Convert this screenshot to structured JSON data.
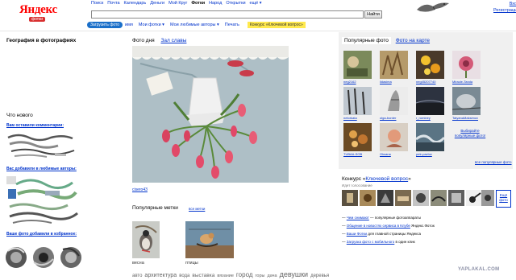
{
  "header": {
    "logo_text": "Яндекс",
    "logo_sub": "фотки",
    "services": [
      "Поиск",
      "Почта",
      "Календарь",
      "Деньги",
      "Мой Круг",
      "Фотки",
      "Народ",
      "Открытки",
      "ещё ▾"
    ],
    "current_service_index": 5,
    "search_button": "Найти",
    "login": "Вход",
    "register": "Регистрация"
  },
  "subnav": {
    "upload": "Загрузить фото",
    "user": "имя",
    "items": [
      "Мои фотки ▾",
      "Мои любимые авторы ▾",
      "Печать"
    ],
    "contest": "Конкурс «Ключевой вопрос»"
  },
  "left": {
    "geo_title": "География в фотографиях",
    "whatsnew_title": "Что нового",
    "new_comments": "Вам оставили комментарии:",
    "new_authors": "Вас добавили в любимые авторы:",
    "new_favorites": "Ваше фото добавили в избранное:"
  },
  "middle": {
    "tab_day": "Фото дня",
    "tab_fame": "Зал славы",
    "author": "cisero43",
    "tags_title": "Популярные метки",
    "tags_all": "все метки",
    "tag1": "весна",
    "tag2": "птицы",
    "tag_cloud": [
      {
        "t": "авто",
        "s": 6
      },
      {
        "t": "архитектура",
        "s": 7
      },
      {
        "t": "вода",
        "s": 6
      },
      {
        "t": "выставка",
        "s": 6.5
      },
      {
        "t": "вязание",
        "s": 5.5
      },
      {
        "t": "город",
        "s": 8
      },
      {
        "t": "горы",
        "s": 5.5
      },
      {
        "t": "дача",
        "s": 5.5
      },
      {
        "t": "девушки",
        "s": 9
      },
      {
        "t": "деревья",
        "s": 6
      }
    ]
  },
  "right": {
    "tab_popular": "Популярные фото",
    "tab_map": "Фото на карте",
    "captions": [
      "neg2162",
      "ildasima",
      "neg45207740",
      "Miracle-Tanda",
      "netorkata",
      "olga-border",
      "r_rominey",
      "TatyanaMaksimov",
      "TUBAA-SOB",
      "Oksana",
      "petr-pavlov"
    ],
    "choose_popular": "Выбирайте популярные фото!",
    "all_popular": "все популярные фото",
    "contest_title_prefix": "Конкурс «",
    "contest_title_link": "Ключевой вопрос",
    "contest_title_suffix": "»",
    "contest_sub": "Идет голосование",
    "vote": "Ещё фото",
    "features": [
      {
        "link": "Чем снимают",
        "rest": " — популярные фотоаппараты"
      },
      {
        "link": "Общение в новостях сервиса в Клубе",
        "rest": " Яндекс.Фоток"
      },
      {
        "link": "Ваши Фотки",
        "rest": " для главной страницы Яндекса"
      },
      {
        "link": "Загрузка фото с мобильного",
        "rest": " в один клик"
      }
    ]
  },
  "watermark": "YAPLAKAL.COM",
  "colors": {
    "link": "#0033cc",
    "upload": "#1a6fc9",
    "contest_badge": "#ffe94d",
    "panel": "#f0f0f0"
  }
}
